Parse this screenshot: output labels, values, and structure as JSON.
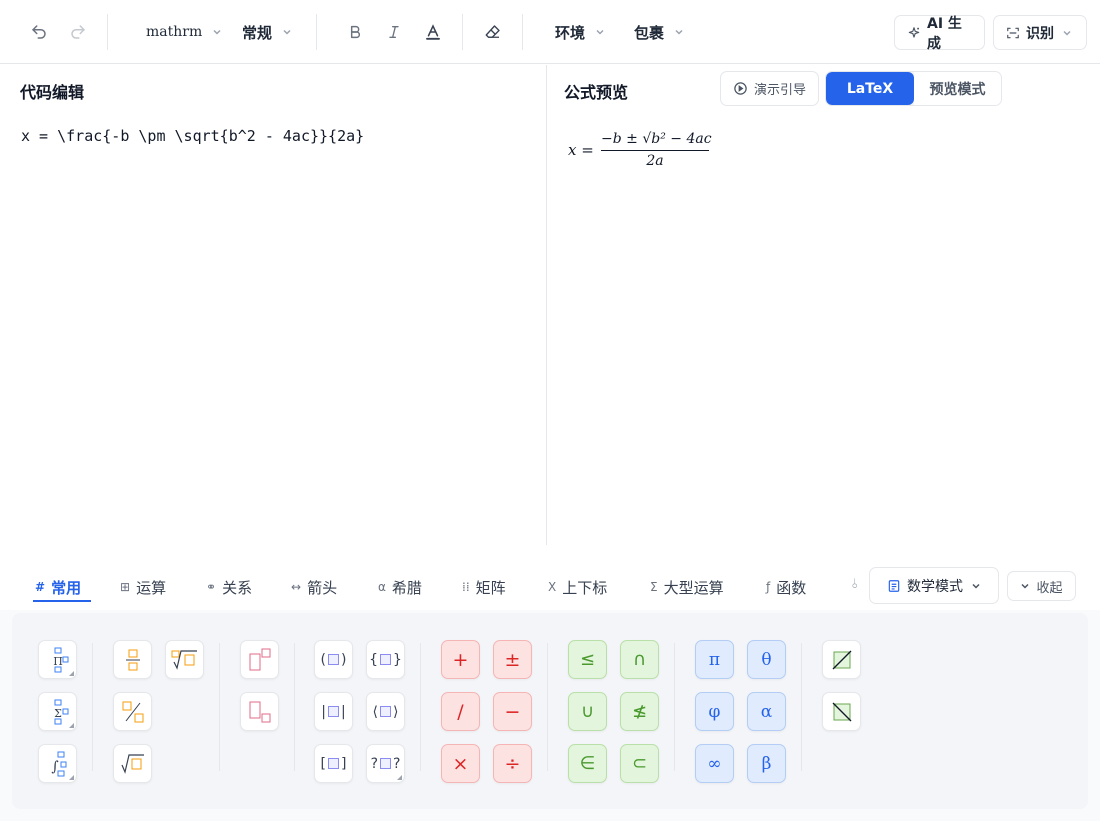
{
  "toolbar": {
    "font_family_value": "mathrm",
    "font_style_value": "常规",
    "environment_label": "环境",
    "wrap_label": "包裹",
    "ai_generate_label": "AI 生成",
    "recognize_label": "识别"
  },
  "editor": {
    "title": "代码编辑",
    "code": "x = \\frac{-b \\pm \\sqrt{b^2 - 4ac}}{2a}"
  },
  "preview": {
    "title": "公式预览",
    "guide_label": "演示引导",
    "mode_latex": "LaTeX",
    "mode_preview": "预览模式",
    "formula": {
      "lhs": "x =",
      "numerator": "−b ± √b² − 4ac",
      "denominator": "2a"
    }
  },
  "tabs": [
    {
      "label": "常用",
      "icon": "#"
    },
    {
      "label": "运算",
      "icon": "⊞"
    },
    {
      "label": "关系",
      "icon": "⚭"
    },
    {
      "label": "箭头",
      "icon": "↔"
    },
    {
      "label": "希腊",
      "icon": "α"
    },
    {
      "label": "矩阵",
      "icon": "⁞⁞"
    },
    {
      "label": "上下标",
      "icon": "X"
    },
    {
      "label": "大型运算",
      "icon": "Σ"
    },
    {
      "label": "函数",
      "icon": "ƒ"
    }
  ],
  "active_tab": "常用",
  "math_mode_label": "数学模式",
  "collapse_label": "收起",
  "palette": {
    "bracket_keys": [
      "(□)",
      "{□}",
      "|□|",
      "⟨□⟩",
      "[□]",
      "?□?"
    ],
    "arithmetic": [
      "+",
      "±",
      "/",
      "−",
      "×",
      "÷"
    ],
    "relations": [
      "≤",
      "∩",
      "∪",
      "≰",
      "∈",
      "⊂"
    ],
    "greek": [
      "π",
      "θ",
      "φ",
      "α",
      "∞",
      "β"
    ]
  },
  "colors": {
    "accent": "#2563eb",
    "arith_bg": "#fde2e2",
    "relation_bg": "#e3f5dc",
    "greek_bg": "#e0ebfd"
  }
}
